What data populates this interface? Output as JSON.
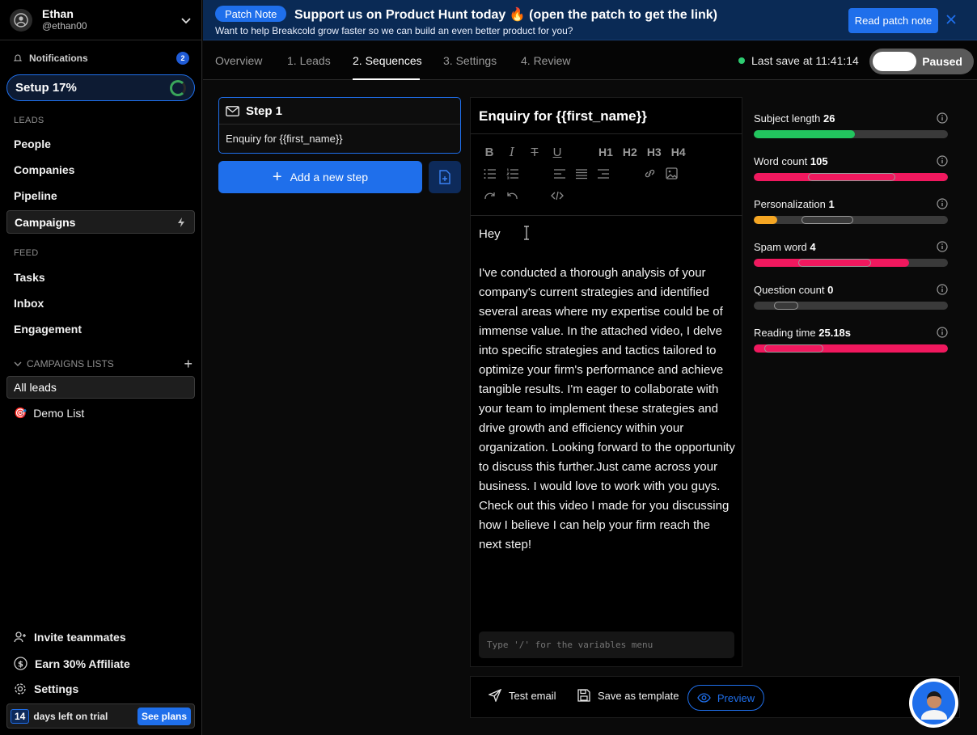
{
  "user": {
    "name": "Ethan",
    "handle": "@ethan00"
  },
  "sidebar": {
    "notifications_label": "Notifications",
    "notifications_count": "2",
    "setup_label": "Setup 17%",
    "setup_progress": 0.17,
    "leads_section": "LEADS",
    "leads_items": [
      "People",
      "Companies",
      "Pipeline",
      "Campaigns"
    ],
    "feed_section": "FEED",
    "feed_items": [
      "Tasks",
      "Inbox",
      "Engagement"
    ],
    "campaigns_lists_label": "CAMPAIGNS LISTS",
    "all_leads": "All leads",
    "demo_list": "Demo List",
    "invite": "Invite teammates",
    "affiliate": "Earn 30% Affiliate",
    "settings": "Settings",
    "trial_days": "14",
    "trial_text": "days left on trial",
    "see_plans": "See plans"
  },
  "banner": {
    "pill": "Patch Note",
    "headline": "Support us on Product Hunt today 🔥 (open the patch to get the link)",
    "sub": "Want to help Breakcold grow faster so we can build an even better product for you?",
    "read_button": "Read patch note"
  },
  "tabs": [
    "Overview",
    "1. Leads",
    "2. Sequences",
    "3. Settings",
    "4. Review"
  ],
  "active_tab": "2. Sequences",
  "last_save": "Last save at 11:41:14",
  "toggle_label": "Paused",
  "step": {
    "title": "Step 1",
    "subject": "Enquiry for {{first_name}}"
  },
  "add_step": "Add a new step",
  "editor": {
    "subject": "Enquiry for {{first_name}}",
    "headings": [
      "H1",
      "H2",
      "H3",
      "H4"
    ],
    "greeting": "Hey",
    "body": "I've conducted a thorough analysis of your company's current strategies and identified several areas where my expertise could be of immense value. In the attached video, I delve into specific strategies and tactics tailored to optimize your firm's performance and achieve tangible results. I'm eager to collaborate with your team to implement these strategies and drive growth and efficiency within your organization. Looking forward to the opportunity to discuss this further.Just came across your business. I would love to work with you guys. Check out this video I made for you discussing how I believe I can help your firm reach the next step!",
    "variables_placeholder": "Type '/' for the variables menu"
  },
  "metrics": [
    {
      "label": "Subject length",
      "value": "26",
      "fill_color": "#22c55e",
      "fill_fraction": 0.52
    },
    {
      "label": "Word count",
      "value": "105",
      "fill_color": "#f0185e",
      "fill_fraction": 1.0
    },
    {
      "label": "Personalization",
      "value": "1",
      "fill_color": "#f5a623",
      "fill_fraction": 0.12
    },
    {
      "label": "Spam word",
      "value": "4",
      "fill_color": "#f0185e",
      "fill_fraction": 0.8
    },
    {
      "label": "Question count",
      "value": "0",
      "fill_color": "#3a3a3a",
      "fill_fraction": 0.0
    },
    {
      "label": "Reading time",
      "value": "25.18s",
      "fill_color": "#f0185e",
      "fill_fraction": 1.0
    }
  ],
  "bottom": {
    "test_email": "Test email",
    "save_template": "Save as template",
    "preview": "Preview"
  },
  "colors": {
    "accent": "#1f6feb",
    "success": "#22c55e",
    "danger": "#f0185e",
    "warning": "#f5a623"
  }
}
